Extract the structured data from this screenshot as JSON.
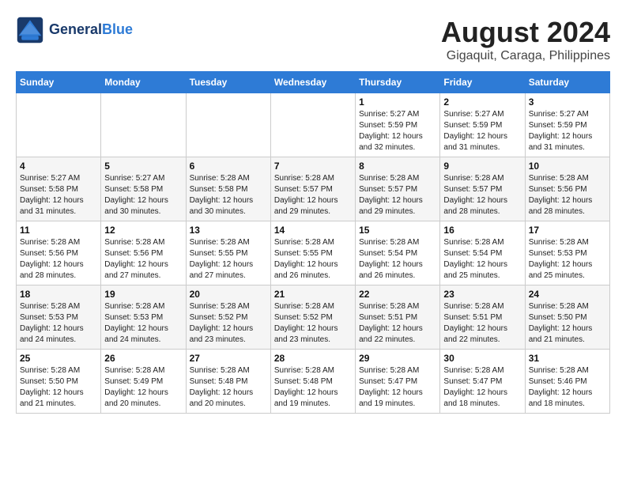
{
  "header": {
    "logo": {
      "line1": "General",
      "line2": "Blue"
    },
    "month_year": "August 2024",
    "location": "Gigaquit, Caraga, Philippines"
  },
  "weekdays": [
    "Sunday",
    "Monday",
    "Tuesday",
    "Wednesday",
    "Thursday",
    "Friday",
    "Saturday"
  ],
  "weeks": [
    [
      {
        "day": "",
        "info": ""
      },
      {
        "day": "",
        "info": ""
      },
      {
        "day": "",
        "info": ""
      },
      {
        "day": "",
        "info": ""
      },
      {
        "day": "1",
        "info": "Sunrise: 5:27 AM\nSunset: 5:59 PM\nDaylight: 12 hours\nand 32 minutes."
      },
      {
        "day": "2",
        "info": "Sunrise: 5:27 AM\nSunset: 5:59 PM\nDaylight: 12 hours\nand 31 minutes."
      },
      {
        "day": "3",
        "info": "Sunrise: 5:27 AM\nSunset: 5:59 PM\nDaylight: 12 hours\nand 31 minutes."
      }
    ],
    [
      {
        "day": "4",
        "info": "Sunrise: 5:27 AM\nSunset: 5:58 PM\nDaylight: 12 hours\nand 31 minutes."
      },
      {
        "day": "5",
        "info": "Sunrise: 5:27 AM\nSunset: 5:58 PM\nDaylight: 12 hours\nand 30 minutes."
      },
      {
        "day": "6",
        "info": "Sunrise: 5:28 AM\nSunset: 5:58 PM\nDaylight: 12 hours\nand 30 minutes."
      },
      {
        "day": "7",
        "info": "Sunrise: 5:28 AM\nSunset: 5:57 PM\nDaylight: 12 hours\nand 29 minutes."
      },
      {
        "day": "8",
        "info": "Sunrise: 5:28 AM\nSunset: 5:57 PM\nDaylight: 12 hours\nand 29 minutes."
      },
      {
        "day": "9",
        "info": "Sunrise: 5:28 AM\nSunset: 5:57 PM\nDaylight: 12 hours\nand 28 minutes."
      },
      {
        "day": "10",
        "info": "Sunrise: 5:28 AM\nSunset: 5:56 PM\nDaylight: 12 hours\nand 28 minutes."
      }
    ],
    [
      {
        "day": "11",
        "info": "Sunrise: 5:28 AM\nSunset: 5:56 PM\nDaylight: 12 hours\nand 28 minutes."
      },
      {
        "day": "12",
        "info": "Sunrise: 5:28 AM\nSunset: 5:56 PM\nDaylight: 12 hours\nand 27 minutes."
      },
      {
        "day": "13",
        "info": "Sunrise: 5:28 AM\nSunset: 5:55 PM\nDaylight: 12 hours\nand 27 minutes."
      },
      {
        "day": "14",
        "info": "Sunrise: 5:28 AM\nSunset: 5:55 PM\nDaylight: 12 hours\nand 26 minutes."
      },
      {
        "day": "15",
        "info": "Sunrise: 5:28 AM\nSunset: 5:54 PM\nDaylight: 12 hours\nand 26 minutes."
      },
      {
        "day": "16",
        "info": "Sunrise: 5:28 AM\nSunset: 5:54 PM\nDaylight: 12 hours\nand 25 minutes."
      },
      {
        "day": "17",
        "info": "Sunrise: 5:28 AM\nSunset: 5:53 PM\nDaylight: 12 hours\nand 25 minutes."
      }
    ],
    [
      {
        "day": "18",
        "info": "Sunrise: 5:28 AM\nSunset: 5:53 PM\nDaylight: 12 hours\nand 24 minutes."
      },
      {
        "day": "19",
        "info": "Sunrise: 5:28 AM\nSunset: 5:53 PM\nDaylight: 12 hours\nand 24 minutes."
      },
      {
        "day": "20",
        "info": "Sunrise: 5:28 AM\nSunset: 5:52 PM\nDaylight: 12 hours\nand 23 minutes."
      },
      {
        "day": "21",
        "info": "Sunrise: 5:28 AM\nSunset: 5:52 PM\nDaylight: 12 hours\nand 23 minutes."
      },
      {
        "day": "22",
        "info": "Sunrise: 5:28 AM\nSunset: 5:51 PM\nDaylight: 12 hours\nand 22 minutes."
      },
      {
        "day": "23",
        "info": "Sunrise: 5:28 AM\nSunset: 5:51 PM\nDaylight: 12 hours\nand 22 minutes."
      },
      {
        "day": "24",
        "info": "Sunrise: 5:28 AM\nSunset: 5:50 PM\nDaylight: 12 hours\nand 21 minutes."
      }
    ],
    [
      {
        "day": "25",
        "info": "Sunrise: 5:28 AM\nSunset: 5:50 PM\nDaylight: 12 hours\nand 21 minutes."
      },
      {
        "day": "26",
        "info": "Sunrise: 5:28 AM\nSunset: 5:49 PM\nDaylight: 12 hours\nand 20 minutes."
      },
      {
        "day": "27",
        "info": "Sunrise: 5:28 AM\nSunset: 5:48 PM\nDaylight: 12 hours\nand 20 minutes."
      },
      {
        "day": "28",
        "info": "Sunrise: 5:28 AM\nSunset: 5:48 PM\nDaylight: 12 hours\nand 19 minutes."
      },
      {
        "day": "29",
        "info": "Sunrise: 5:28 AM\nSunset: 5:47 PM\nDaylight: 12 hours\nand 19 minutes."
      },
      {
        "day": "30",
        "info": "Sunrise: 5:28 AM\nSunset: 5:47 PM\nDaylight: 12 hours\nand 18 minutes."
      },
      {
        "day": "31",
        "info": "Sunrise: 5:28 AM\nSunset: 5:46 PM\nDaylight: 12 hours\nand 18 minutes."
      }
    ]
  ]
}
